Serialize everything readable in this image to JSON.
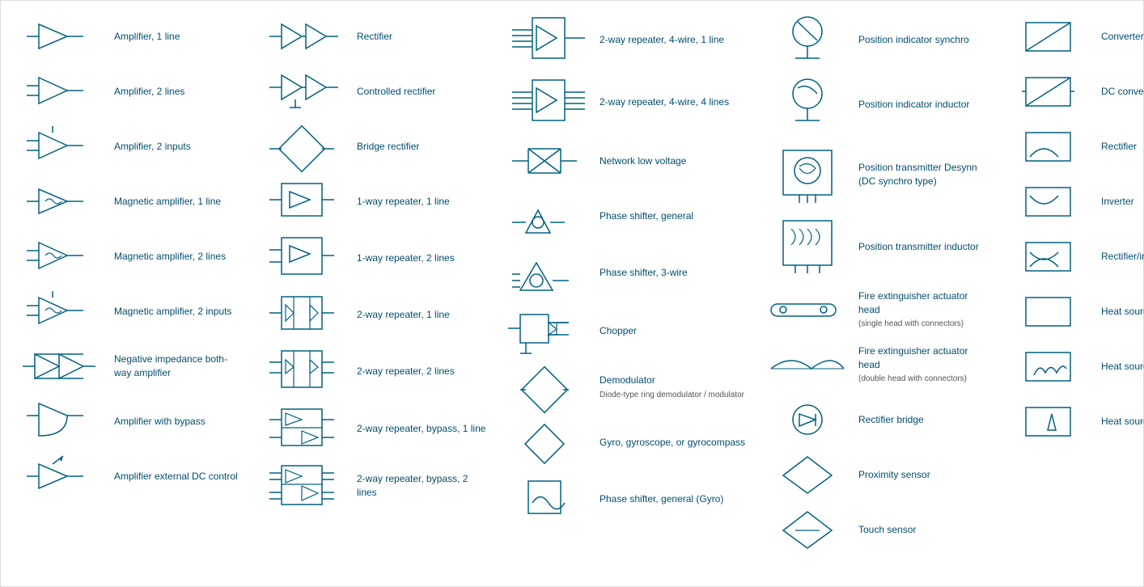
{
  "columns": [
    {
      "id": "col1",
      "items": [
        {
          "id": "amp1",
          "label": "Amplifier, 1 line",
          "symbol": "amp1"
        },
        {
          "id": "amp2",
          "label": "Amplifier, 2 lines",
          "symbol": "amp2"
        },
        {
          "id": "amp3",
          "label": "Amplifier, 2 inputs",
          "symbol": "amp3"
        },
        {
          "id": "mag1",
          "label": "Magnetic amplifier, 1 line",
          "symbol": "mag1"
        },
        {
          "id": "mag2",
          "label": "Magnetic amplifier, 2 lines",
          "symbol": "mag2"
        },
        {
          "id": "mag3",
          "label": "Magnetic amplifier, 2 inputs",
          "symbol": "mag3"
        },
        {
          "id": "neg1",
          "label": "Negative impedance both-way amplifier",
          "symbol": "neg1"
        },
        {
          "id": "amp4",
          "label": "Amplifier with bypass",
          "symbol": "amp4"
        },
        {
          "id": "amp5",
          "label": "Amplifier external DC control",
          "symbol": "amp5"
        }
      ]
    },
    {
      "id": "col2",
      "items": [
        {
          "id": "rect1",
          "label": "Rectifier",
          "symbol": "rect1"
        },
        {
          "id": "rect2",
          "label": "Controlled rectifier",
          "symbol": "rect2"
        },
        {
          "id": "bridge1",
          "label": "Bridge rectifier",
          "symbol": "bridge1"
        },
        {
          "id": "rep1",
          "label": "1-way repeater, 1 line",
          "symbol": "rep1"
        },
        {
          "id": "rep2",
          "label": "1-way repeater, 2 lines",
          "symbol": "rep2"
        },
        {
          "id": "rep3",
          "label": "2-way repeater, 1 line",
          "symbol": "rep3"
        },
        {
          "id": "rep4",
          "label": "2-way repeater, 2 lines",
          "symbol": "rep4"
        },
        {
          "id": "rep5",
          "label": "2-way repeater, bypass, 1 line",
          "symbol": "rep5"
        },
        {
          "id": "rep6",
          "label": "2-way repeater, bypass, 2 lines",
          "symbol": "rep6"
        }
      ]
    },
    {
      "id": "col3",
      "items": [
        {
          "id": "rep7",
          "label": "2-way repeater, 4-wire, 1 line",
          "symbol": "rep7"
        },
        {
          "id": "rep8",
          "label": "2-way repeater, 4-wire, 4 lines",
          "symbol": "rep8"
        },
        {
          "id": "net1",
          "label": "Network low voltage",
          "symbol": "net1"
        },
        {
          "id": "phase1",
          "label": "Phase shifter, general",
          "symbol": "phase1"
        },
        {
          "id": "phase2",
          "label": "Phase shifter, 3-wire",
          "symbol": "phase2"
        },
        {
          "id": "chop1",
          "label": "Chopper",
          "symbol": "chop1"
        },
        {
          "id": "demod1",
          "label": "Demodulator",
          "sublabel": "Diode-type ring demodulator / modulator",
          "symbol": "demod1"
        },
        {
          "id": "gyro1",
          "label": "Gyro, gyroscope, or gyrocompass",
          "symbol": "gyro1"
        },
        {
          "id": "phase3",
          "label": "Phase shifter, general (Gyro)",
          "symbol": "phase3"
        }
      ]
    },
    {
      "id": "col4",
      "items": [
        {
          "id": "pos1",
          "label": "Position indicator synchro",
          "symbol": "pos1"
        },
        {
          "id": "pos2",
          "label": "Position indicator inductor",
          "symbol": "pos2"
        },
        {
          "id": "postrans1",
          "label": "Position transmitter Desynn (DC synchro type)",
          "symbol": "postrans1"
        },
        {
          "id": "postrans2",
          "label": "Position transmitter inductor",
          "symbol": "postrans2"
        },
        {
          "id": "fire1",
          "label": "Fire extinguisher actuator head",
          "sublabel": "(single head with connectors)",
          "symbol": "fire1"
        },
        {
          "id": "fire2",
          "label": "Fire extinguisher actuator head",
          "sublabel": "(double head with connectors)",
          "symbol": "fire2"
        },
        {
          "id": "rectb1",
          "label": "Rectifier bridge",
          "symbol": "rectb1"
        },
        {
          "id": "prox1",
          "label": "Proximity sensor",
          "symbol": "prox1"
        },
        {
          "id": "touch1",
          "label": "Touch sensor",
          "symbol": "touch1"
        }
      ]
    },
    {
      "id": "col5",
      "items": [
        {
          "id": "conv1",
          "label": "Converter, general",
          "symbol": "conv1"
        },
        {
          "id": "dc1",
          "label": "DC converter",
          "symbol": "dc1"
        },
        {
          "id": "rect3",
          "label": "Rectifier",
          "symbol": "rect3b"
        },
        {
          "id": "inv1",
          "label": "Inverter",
          "symbol": "inv1"
        },
        {
          "id": "rectinv1",
          "label": "Rectifier/inverter",
          "symbol": "rectinv1"
        },
        {
          "id": "heat1",
          "label": "Heat source, general",
          "symbol": "heat1"
        },
        {
          "id": "heat2",
          "label": "Heat source, radioisotope",
          "symbol": "heat2"
        },
        {
          "id": "heat3",
          "label": "Heat source, combustion",
          "symbol": "heat3"
        }
      ]
    }
  ]
}
